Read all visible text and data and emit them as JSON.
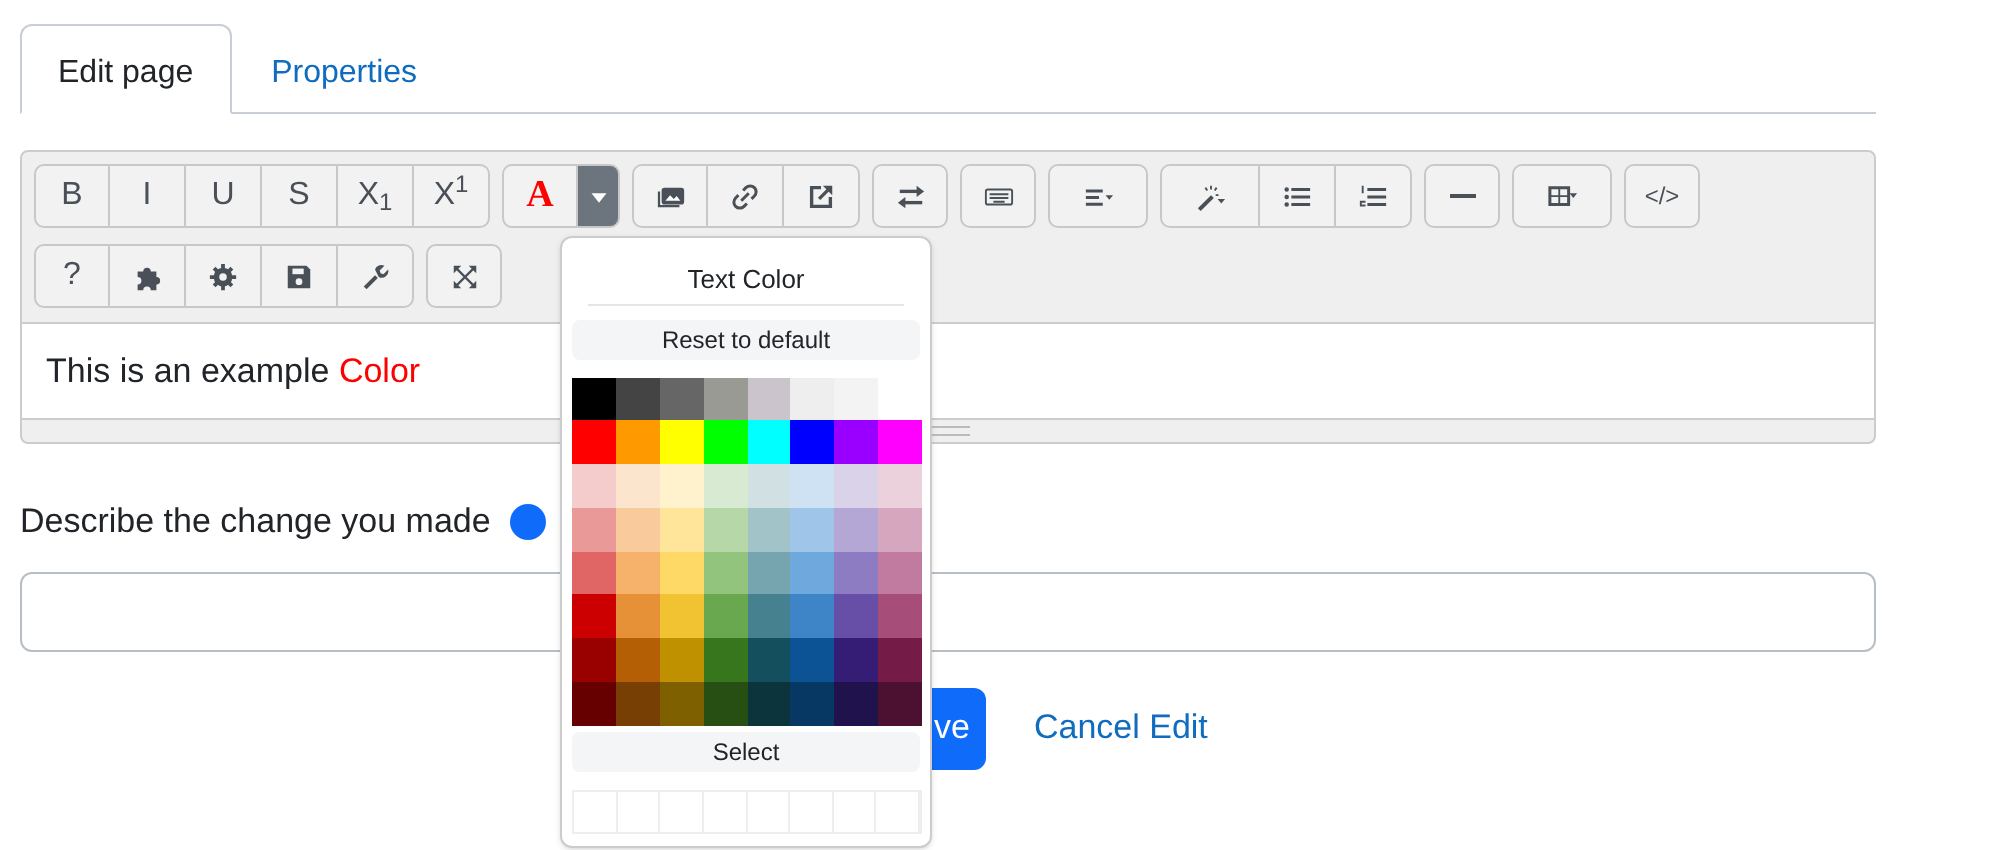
{
  "tabs": [
    {
      "label": "Edit page",
      "selected": true
    },
    {
      "label": "Properties",
      "selected": false
    }
  ],
  "toolbar": {
    "rows": [
      [
        [
          {
            "kind": "text",
            "label": "B"
          },
          {
            "kind": "text",
            "label": "I"
          },
          {
            "kind": "text",
            "label": "U"
          },
          {
            "kind": "text",
            "label": "S"
          },
          {
            "kind": "text",
            "label": "X$_{1}$"
          },
          {
            "kind": "text",
            "label": "X$^{1}$"
          }
        ],
        [
          {
            "kind": "color",
            "label": "A"
          },
          {
            "kind": "caret",
            "active": true
          }
        ],
        [
          {
            "kind": "image"
          },
          {
            "kind": "link"
          },
          {
            "kind": "external"
          }
        ],
        [
          {
            "kind": "swap"
          }
        ],
        [
          {
            "kind": "keyboard"
          }
        ],
        [
          {
            "kind": "align"
          }
        ],
        [
          {
            "kind": "magic"
          },
          {
            "kind": "bullets"
          },
          {
            "kind": "numbers"
          }
        ],
        [
          {
            "kind": "rule"
          }
        ],
        [
          {
            "kind": "table"
          }
        ],
        [
          {
            "kind": "code",
            "label": "</>"
          }
        ]
      ],
      [
        [
          {
            "kind": "text",
            "label": "?"
          },
          {
            "kind": "puzzle"
          },
          {
            "kind": "gear"
          },
          {
            "kind": "save"
          },
          {
            "kind": "wrench"
          }
        ],
        [
          {
            "kind": "expand"
          }
        ]
      ]
    ]
  },
  "editor": {
    "runs": [
      {
        "text": "This is an example "
      },
      {
        "text": "Color",
        "color": "#ff0000"
      }
    ]
  },
  "change": {
    "label": "Describe the change you made"
  },
  "actions": {
    "save": "ve",
    "cancel": "Cancel Edit"
  },
  "popup": {
    "title": "Text Color",
    "reset": "Reset to default",
    "select": "Select",
    "swatches": [
      [
        {
          "color": "#000000"
        },
        {
          "color": "#444444"
        },
        {
          "color": "#666666"
        },
        {
          "color": "#9a9a94"
        },
        {
          "color": "#ccc4cc"
        },
        {
          "color": "#eeeeee"
        },
        {
          "color": "#f3f3f3"
        }
      ],
      [
        {
          "color": "#ff0000"
        },
        {
          "color": "#ff9900"
        },
        {
          "color": "#ffff00"
        },
        {
          "color": "#00ff00"
        },
        {
          "color": "#00ffff"
        },
        {
          "color": "#0000ff"
        },
        {
          "color": "#9900ff"
        },
        {
          "color": "#ff00ff"
        }
      ],
      [
        {
          "color": "#f4cccc"
        },
        {
          "color": "#fce5cd"
        },
        {
          "color": "#fff2cc"
        },
        {
          "color": "#d9ead3"
        },
        {
          "color": "#d0e0e3"
        },
        {
          "color": "#cfe2f3"
        },
        {
          "color": "#d9d2e9"
        },
        {
          "color": "#ead1dc"
        }
      ],
      [
        {
          "color": "#ea9999"
        },
        {
          "color": "#f9cb9c"
        },
        {
          "color": "#ffe599"
        },
        {
          "color": "#b6d7a8"
        },
        {
          "color": "#a2c4c9"
        },
        {
          "color": "#9fc5e8"
        },
        {
          "color": "#b4a7d6"
        },
        {
          "color": "#d5a6bd"
        }
      ],
      [
        {
          "color": "#e06666"
        },
        {
          "color": "#f6b26b"
        },
        {
          "color": "#ffd966"
        },
        {
          "color": "#93c47d"
        },
        {
          "color": "#76a5af"
        },
        {
          "color": "#6fa8dc"
        },
        {
          "color": "#8e7cc3"
        },
        {
          "color": "#c27ba0"
        }
      ],
      [
        {
          "color": "#cc0000"
        },
        {
          "color": "#e69138"
        },
        {
          "color": "#f1c232"
        },
        {
          "color": "#6aa84f"
        },
        {
          "color": "#45818e"
        },
        {
          "color": "#3d85c6"
        },
        {
          "color": "#674ea7"
        },
        {
          "color": "#a64d79"
        }
      ],
      [
        {
          "color": "#990000"
        },
        {
          "color": "#b45f06"
        },
        {
          "color": "#bf9000"
        },
        {
          "color": "#38761d"
        },
        {
          "color": "#134f5c"
        },
        {
          "color": "#0b5394"
        },
        {
          "color": "#351c75"
        },
        {
          "color": "#741b47"
        }
      ],
      [
        {
          "color": "#660000"
        },
        {
          "color": "#783f04"
        },
        {
          "color": "#7f6000"
        },
        {
          "color": "#274e13"
        },
        {
          "color": "#0c343d"
        },
        {
          "color": "#073763"
        },
        {
          "color": "#20124d"
        },
        {
          "color": "#4c1130"
        }
      ]
    ]
  }
}
